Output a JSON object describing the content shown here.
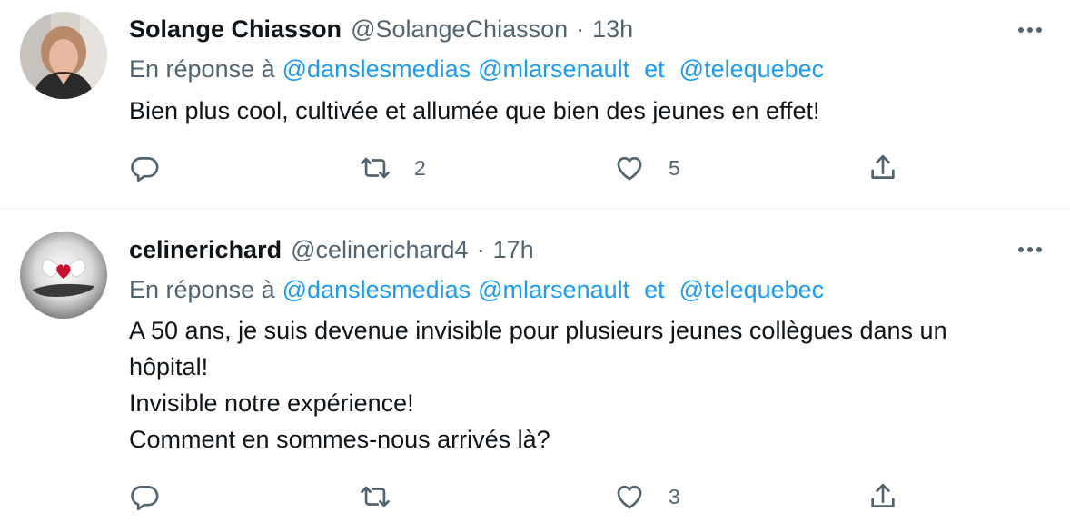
{
  "tweets": [
    {
      "name": "Solange Chiasson",
      "handle": "@SolangeChiasson",
      "separator": "·",
      "time": "13h",
      "reply_prefix": "En réponse à",
      "mentions": [
        "@danslesmedias",
        "@mlarsenault",
        "@telequebec"
      ],
      "conjunction": "et",
      "text_lines": [
        "Bien plus cool, cultivée et allumée que bien des jeunes en effet!"
      ],
      "retweets": "2",
      "likes": "5"
    },
    {
      "name": "celinerichard",
      "handle": "@celinerichard4",
      "separator": "·",
      "time": "17h",
      "reply_prefix": "En réponse à",
      "mentions": [
        "@danslesmedias",
        "@mlarsenault",
        "@telequebec"
      ],
      "conjunction": "et",
      "text_lines": [
        "A 50 ans, je suis devenue invisible pour plusieurs jeunes collègues dans un",
        "hôpital!",
        "Invisible notre expérience!",
        "Comment en sommes-nous arrivés là?"
      ],
      "retweets": "",
      "likes": "3"
    }
  ],
  "icons": {
    "reply": "reply-icon",
    "retweet": "retweet-icon",
    "like": "heart-icon",
    "share": "share-icon",
    "more": "more-icon"
  },
  "colors": {
    "text_primary": "#0f1419",
    "text_secondary": "#536471",
    "link": "#1d9bf0",
    "divider": "#eff3f4"
  }
}
